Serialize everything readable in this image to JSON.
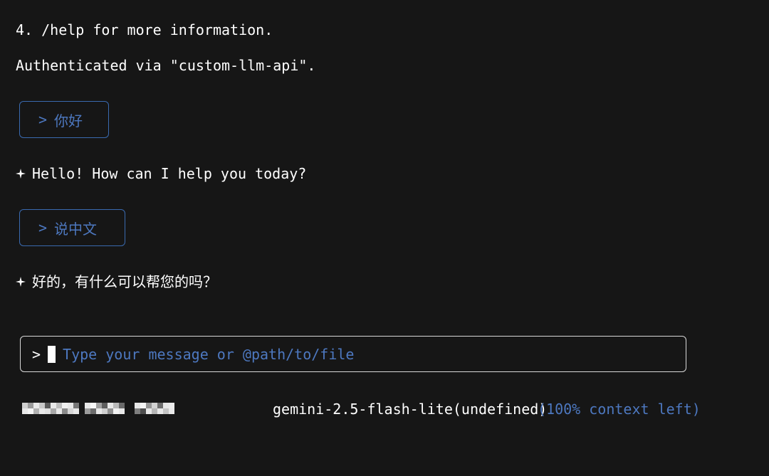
{
  "output": {
    "help_line": "4. /help for more information.",
    "auth_line": "Authenticated via \"custom-llm-api\"."
  },
  "messages": [
    {
      "role": "user",
      "text": "你好"
    },
    {
      "role": "assistant",
      "text": "Hello! How can I help you today?"
    },
    {
      "role": "user",
      "text": "说中文"
    },
    {
      "role": "assistant",
      "text": "好的，有什么可以帮您的吗？"
    }
  ],
  "prompt_symbol": ">",
  "sparkle_icon": "sparkle-icon",
  "input": {
    "prompt": ">",
    "placeholder": "Type your message or @path/to/file",
    "value": ""
  },
  "status_bar": {
    "model": "gemini-2.5-flash-lite(undefined)",
    "context": "(100% context left)"
  },
  "colors": {
    "background": "#161616",
    "accent_blue": "#4d78c0",
    "text": "#ffffff"
  }
}
